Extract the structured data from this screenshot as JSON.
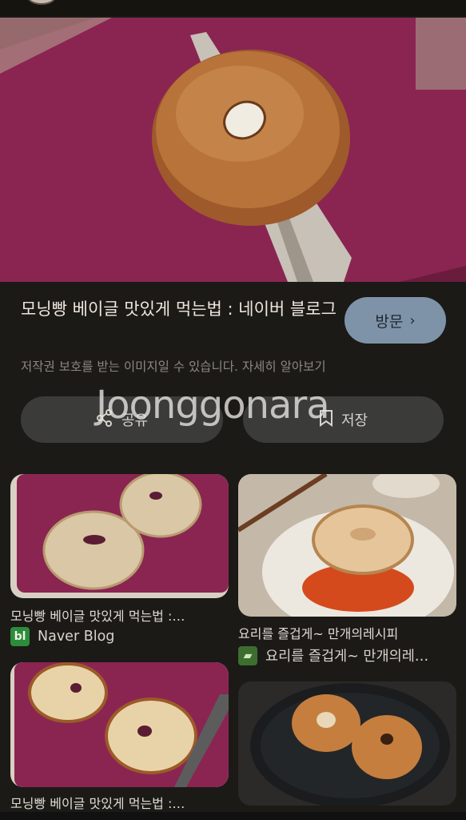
{
  "main_result": {
    "title": "모닝빵 베이글 맛있게 먹는법 : 네이버 블로그",
    "visit_label": "방문",
    "copyright_note": "저작권 보호를 받는 이미지일 수 있습니다. 자세히 알아보기",
    "share_label": "공유",
    "save_label": "저장"
  },
  "watermark": "Joonggonara",
  "related": [
    {
      "caption": "모닝빵 베이글 맛있게 먹는법 :…",
      "source": "Naver Blog",
      "source_logo": "bl"
    },
    {
      "caption": "요리를 즐겁게~ 만개의레시피",
      "source": "요리를 즐겁게~ 만개의레…",
      "source_logo": "recipe"
    },
    {
      "caption": "모닝빵 베이글 맛있게 먹는법 :…"
    }
  ],
  "colors": {
    "background": "#1b1a17",
    "visit_button": "#7f93a8",
    "action_button": "#3b3b39",
    "cutting_board": "#8a2552"
  }
}
